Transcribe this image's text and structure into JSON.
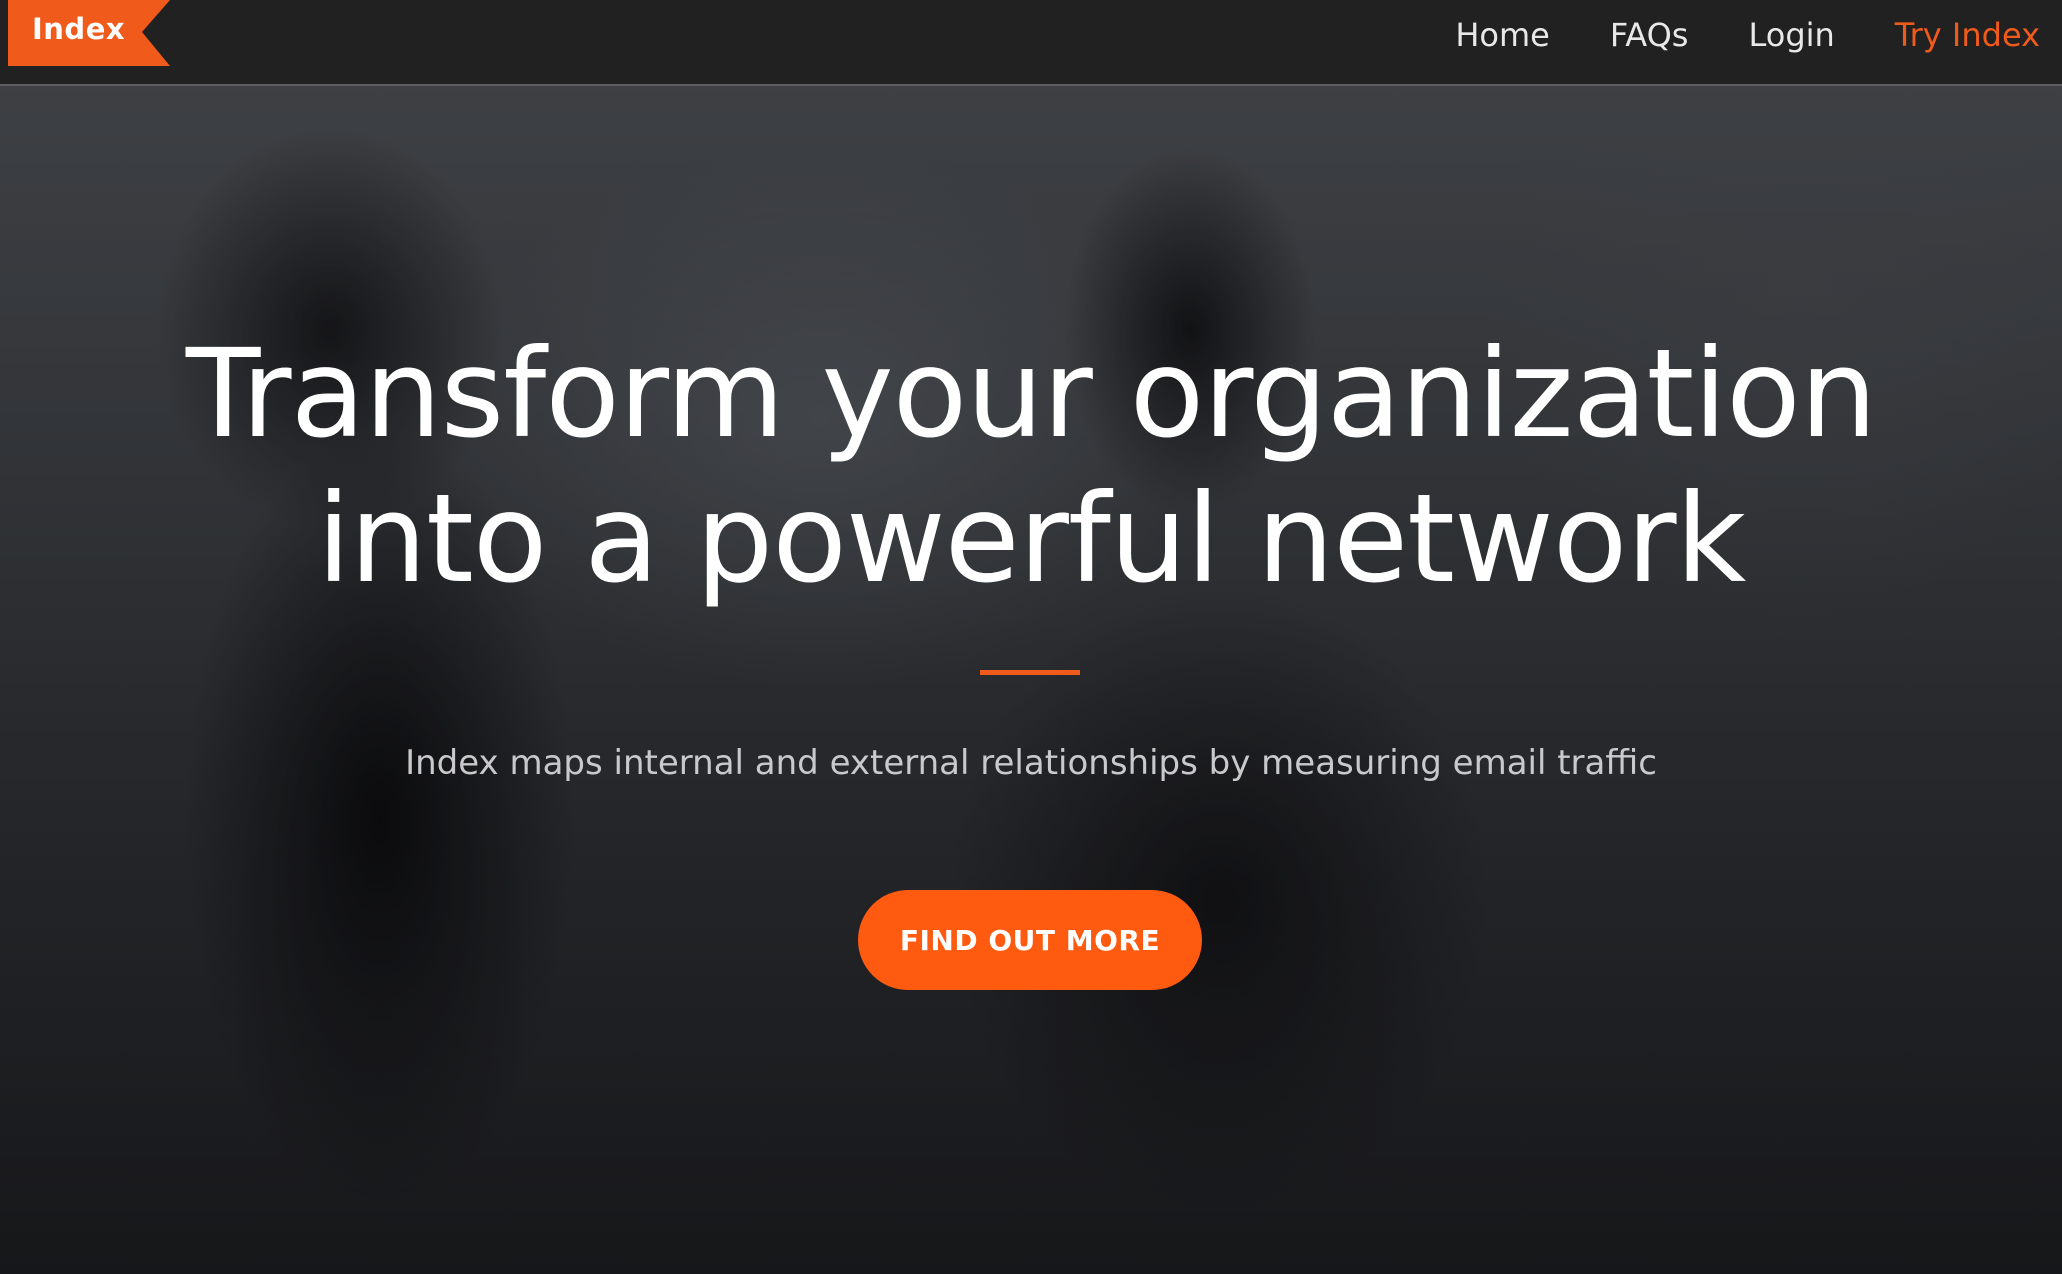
{
  "navbar": {
    "brand_label": "Index",
    "links": [
      {
        "label": "Home"
      },
      {
        "label": "FAQs"
      },
      {
        "label": "Login"
      },
      {
        "label": "Try Index"
      }
    ]
  },
  "hero": {
    "title_line1": "Transform your organization",
    "title_line2": "into a powerful network",
    "subtitle": "Index maps internal and external relationships by measuring email traffic",
    "cta_label": "FIND OUT MORE"
  },
  "colors": {
    "accent": "#f05a1a",
    "cta": "#fe5a10",
    "text_primary": "#ffffff",
    "text_secondary": "#c9c9cb"
  }
}
